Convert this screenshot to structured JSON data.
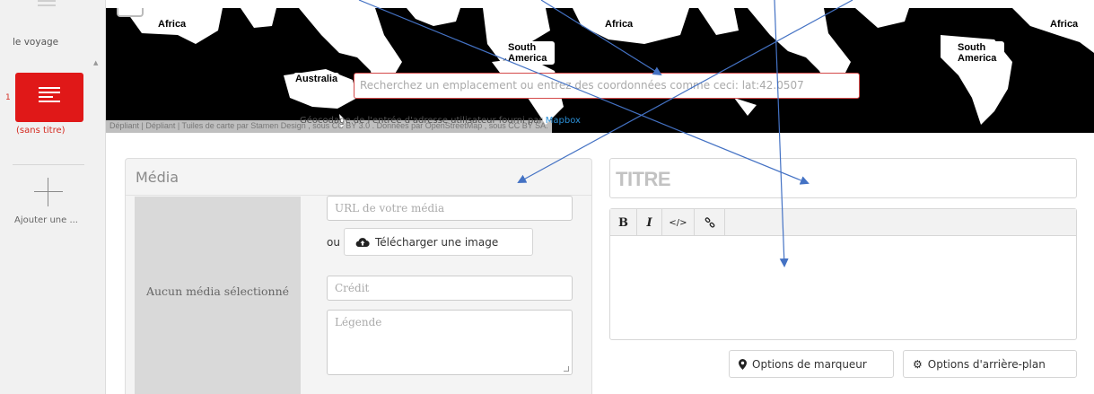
{
  "sidebar": {
    "voyage_label": "le voyage",
    "slide_number": "1",
    "slide_label": "(sans titre)",
    "add_label": "Ajouter une ..."
  },
  "map": {
    "labels": {
      "africa": "Africa",
      "south_america": "South America",
      "australia": "Australia"
    },
    "search_placeholder": "Recherchez un emplacement ou entrez des coordonnées comme ceci: lat:42.0507",
    "attribution": "Dépliant | Dépliant | Tuiles de carte par Stamen Design , sous CC BY 3.0 . Données par OpenStreetMap , sous CC BY SA.",
    "geocode_text": "Géocodage de l'entrée d'adresse utilisateur fourni par",
    "geocode_link": "Mapbox"
  },
  "media": {
    "title": "Média",
    "empty_text": "Aucun média sélectionné",
    "url_placeholder": "URL de votre média",
    "or_label": "ou",
    "upload_label": "Télécharger une image",
    "credit_placeholder": "Crédit",
    "caption_placeholder": "Légende"
  },
  "editor": {
    "title_placeholder": "TITRE",
    "toolbar": {
      "bold": "B",
      "italic": "I",
      "code": "</>"
    }
  },
  "options": {
    "marker_label": "Options de marqueur",
    "background_label": "Options d'arrière-plan"
  },
  "colors": {
    "accent_red": "#e01818",
    "link_blue": "#2b8fd6",
    "arrow_blue": "#4472c4"
  },
  "icons": {
    "upload": "cloud-upload-icon",
    "marker": "map-marker-icon",
    "background": "gear-icon",
    "link": "link-icon"
  }
}
